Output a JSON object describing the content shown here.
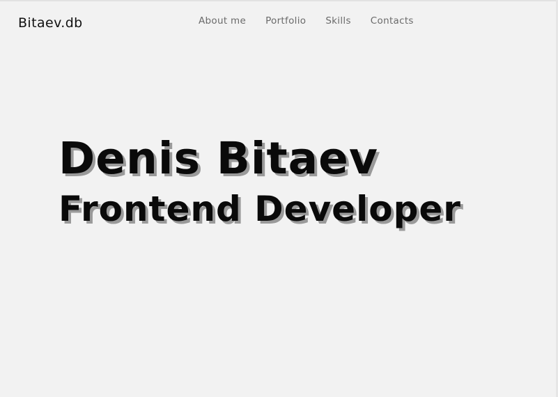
{
  "header": {
    "logo": "Bitaev.db",
    "nav": [
      {
        "label": "About me"
      },
      {
        "label": "Portfolio"
      },
      {
        "label": "Skills"
      },
      {
        "label": "Contacts"
      }
    ]
  },
  "hero": {
    "name": "Denis Bitaev",
    "role": "Frontend Developer"
  },
  "colors": {
    "background": "#f2f2f2",
    "text": "#0a0a0a",
    "nav_text": "#6a6a6a",
    "shadow": "#9a9a9a"
  }
}
